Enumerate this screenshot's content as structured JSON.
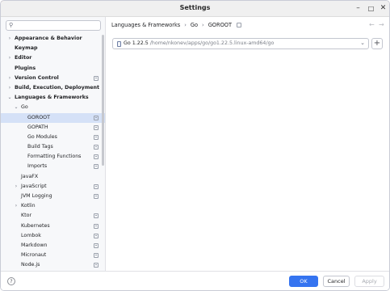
{
  "window": {
    "title": "Settings"
  },
  "search": {
    "placeholder": "",
    "value": ""
  },
  "tree": [
    {
      "label": "Appearance & Behavior",
      "indent": 0,
      "bold": true,
      "chevron": "right",
      "pin": false,
      "selected": false
    },
    {
      "label": "Keymap",
      "indent": 0,
      "bold": true,
      "chevron": "",
      "pin": false,
      "selected": false
    },
    {
      "label": "Editor",
      "indent": 0,
      "bold": true,
      "chevron": "right",
      "pin": false,
      "selected": false
    },
    {
      "label": "Plugins",
      "indent": 0,
      "bold": true,
      "chevron": "",
      "pin": false,
      "selected": false
    },
    {
      "label": "Version Control",
      "indent": 0,
      "bold": true,
      "chevron": "right",
      "pin": true,
      "selected": false
    },
    {
      "label": "Build, Execution, Deployment",
      "indent": 0,
      "bold": true,
      "chevron": "right",
      "pin": false,
      "selected": false
    },
    {
      "label": "Languages & Frameworks",
      "indent": 0,
      "bold": true,
      "chevron": "down",
      "pin": false,
      "selected": false
    },
    {
      "label": "Go",
      "indent": 1,
      "bold": false,
      "chevron": "down",
      "pin": false,
      "selected": false
    },
    {
      "label": "GOROOT",
      "indent": 2,
      "bold": false,
      "chevron": "",
      "pin": true,
      "selected": true
    },
    {
      "label": "GOPATH",
      "indent": 2,
      "bold": false,
      "chevron": "",
      "pin": true,
      "selected": false
    },
    {
      "label": "Go Modules",
      "indent": 2,
      "bold": false,
      "chevron": "",
      "pin": true,
      "selected": false
    },
    {
      "label": "Build Tags",
      "indent": 2,
      "bold": false,
      "chevron": "",
      "pin": true,
      "selected": false
    },
    {
      "label": "Formatting Functions",
      "indent": 2,
      "bold": false,
      "chevron": "",
      "pin": true,
      "selected": false
    },
    {
      "label": "Imports",
      "indent": 2,
      "bold": false,
      "chevron": "",
      "pin": true,
      "selected": false
    },
    {
      "label": "JavaFX",
      "indent": 1,
      "bold": false,
      "chevron": "",
      "pin": false,
      "selected": false
    },
    {
      "label": "JavaScript",
      "indent": 1,
      "bold": false,
      "chevron": "right",
      "pin": true,
      "selected": false
    },
    {
      "label": "JVM Logging",
      "indent": 1,
      "bold": false,
      "chevron": "",
      "pin": true,
      "selected": false
    },
    {
      "label": "Kotlin",
      "indent": 1,
      "bold": false,
      "chevron": "right",
      "pin": false,
      "selected": false
    },
    {
      "label": "Ktor",
      "indent": 1,
      "bold": false,
      "chevron": "",
      "pin": true,
      "selected": false
    },
    {
      "label": "Kubernetes",
      "indent": 1,
      "bold": false,
      "chevron": "",
      "pin": true,
      "selected": false
    },
    {
      "label": "Lombok",
      "indent": 1,
      "bold": false,
      "chevron": "",
      "pin": true,
      "selected": false
    },
    {
      "label": "Markdown",
      "indent": 1,
      "bold": false,
      "chevron": "",
      "pin": true,
      "selected": false
    },
    {
      "label": "Micronaut",
      "indent": 1,
      "bold": false,
      "chevron": "",
      "pin": true,
      "selected": false
    },
    {
      "label": "Node.js",
      "indent": 1,
      "bold": false,
      "chevron": "",
      "pin": true,
      "selected": false
    }
  ],
  "breadcrumb": {
    "items": [
      "Languages & Frameworks",
      "Go",
      "GOROOT"
    ],
    "separator": "›"
  },
  "sdk": {
    "version": "Go 1.22.5",
    "path": "/home/nkonev/apps/go/go1.22.5.linux-amd64/go"
  },
  "buttons": {
    "ok": "OK",
    "cancel": "Cancel",
    "apply": "Apply",
    "help": "?",
    "add": "+"
  },
  "icons": {
    "search": "search-icon",
    "minimize": "minimize-icon",
    "maximize": "maximize-icon",
    "close": "close-icon",
    "go_sdk": "go-sdk-icon",
    "dropdown": "chevron-down-icon"
  },
  "colors": {
    "accent": "#3574f0",
    "selection": "#d5e1f7",
    "sidebar_bg": "#f7f8fa"
  }
}
